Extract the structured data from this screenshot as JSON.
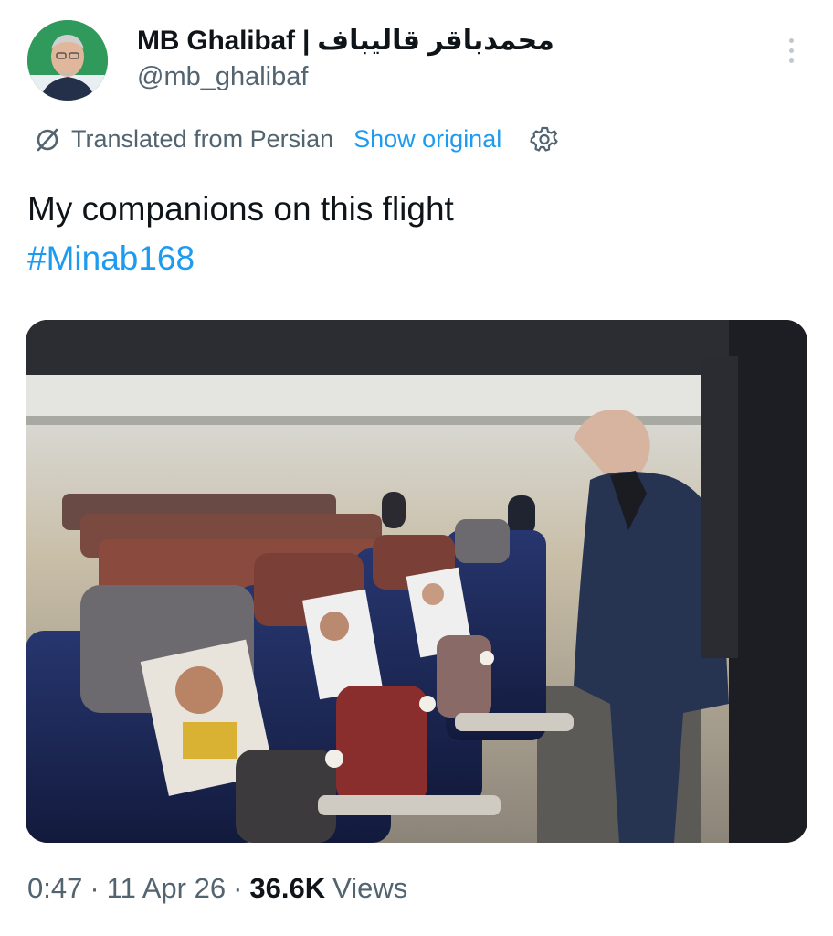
{
  "author": {
    "display_name": "MB Ghalibaf | محمدباقر قالیباف",
    "handle": "@mb_ghalibaf"
  },
  "translation": {
    "label": "Translated from Persian",
    "show_original": "Show original"
  },
  "tweet": {
    "text": "My companions on this flight",
    "hashtag": "#Minab168"
  },
  "meta": {
    "time": "0:47",
    "separator": "·",
    "date": "11 Apr 26",
    "views_count": "36.6K",
    "views_label": "Views"
  },
  "colors": {
    "link": "#1d9bf0",
    "muted": "#536471",
    "text": "#0f1419"
  },
  "icons": [
    "more-icon",
    "translate-icon",
    "gear-icon"
  ]
}
